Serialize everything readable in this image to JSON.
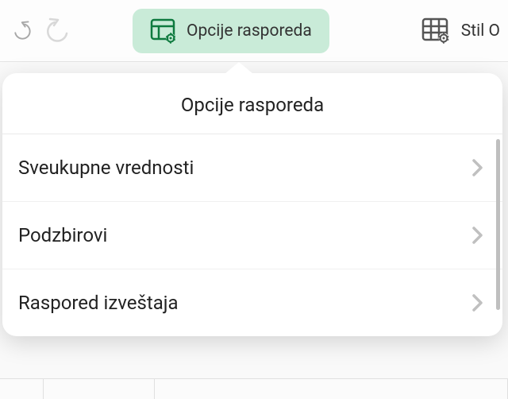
{
  "toolbar": {
    "layout_options_label": "Opcije rasporeda",
    "style_label": "Stil O"
  },
  "popup": {
    "title": "Opcije rasporeda",
    "items": [
      {
        "label": "Sveukupne vrednosti"
      },
      {
        "label": "Podzbirovi"
      },
      {
        "label": "Raspored izveštaja"
      }
    ]
  },
  "colors": {
    "accent_green": "#0e7a3f",
    "highlight_bg": "#c9ebd8",
    "icon_gray": "#a8a8a8"
  }
}
